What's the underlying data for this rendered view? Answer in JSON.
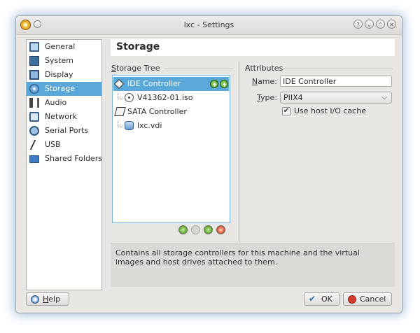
{
  "window": {
    "title": "lxc - Settings"
  },
  "titlebar_buttons": [
    "help",
    "minimize",
    "maximize",
    "close"
  ],
  "sidebar": {
    "items": [
      {
        "label": "General",
        "icon": "general-icon",
        "selected": false
      },
      {
        "label": "System",
        "icon": "system-icon",
        "selected": false
      },
      {
        "label": "Display",
        "icon": "display-icon",
        "selected": false
      },
      {
        "label": "Storage",
        "icon": "storage-icon",
        "selected": true
      },
      {
        "label": "Audio",
        "icon": "audio-icon",
        "selected": false
      },
      {
        "label": "Network",
        "icon": "network-icon",
        "selected": false
      },
      {
        "label": "Serial Ports",
        "icon": "serial-ports-icon",
        "selected": false
      },
      {
        "label": "USB",
        "icon": "usb-icon",
        "selected": false
      },
      {
        "label": "Shared Folders",
        "icon": "shared-folders-icon",
        "selected": false
      }
    ]
  },
  "page": {
    "title": "Storage"
  },
  "storage_tree": {
    "label_prefix": "S",
    "label_rest": "torage Tree",
    "nodes": [
      {
        "label": "IDE Controller",
        "type": "controller",
        "selected": true
      },
      {
        "label": "V41362-01.iso",
        "type": "optical"
      },
      {
        "label": "SATA Controller",
        "type": "controller",
        "selected": false
      },
      {
        "label": "lxc.vdi",
        "type": "hard-disk"
      }
    ],
    "toolbar": [
      "add-attachment",
      "remove-attachment",
      "add-controller",
      "remove-controller"
    ]
  },
  "attributes": {
    "label": "Attributes",
    "name_label_u": "N",
    "name_label_rest": "ame:",
    "name_value": "IDE Controller",
    "type_label_u": "T",
    "type_label_rest": "ype:",
    "type_value": "PIIX4",
    "host_io_cache_label": "Use host I/O cache",
    "host_io_cache_checked": true
  },
  "description": "Contains all storage controllers for this machine and the virtual images and host drives attached to them.",
  "footer": {
    "help_u": "H",
    "help_rest": "elp",
    "ok_label": "OK",
    "cancel_label": "Cancel"
  },
  "colors": {
    "selection": "#5aa7d9",
    "accent_green": "#5aa52a",
    "cancel_red": "#d33b2c"
  }
}
